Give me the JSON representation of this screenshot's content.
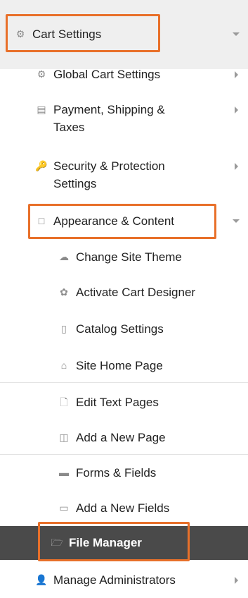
{
  "menu": {
    "cart_settings": {
      "label": "Cart Settings",
      "icon": "gear-icon"
    },
    "global_cart_settings": {
      "label": "Global Cart Settings",
      "icon": "gear-icon"
    },
    "payment_shipping_taxes": {
      "label_line1": "Payment, Shipping &",
      "label_line2": "Taxes",
      "icon": "register-icon"
    },
    "security_protection": {
      "label_line1": "Security & Protection",
      "label_line2": "Settings",
      "icon": "key-icon"
    },
    "appearance_content": {
      "label": "Appearance & Content",
      "icon": "monitor-icon"
    },
    "change_site_theme": {
      "label": "Change Site Theme",
      "icon": "cloud-icon"
    },
    "activate_cart_designer": {
      "label": "Activate Cart Designer",
      "icon": "palette-icon"
    },
    "catalog_settings": {
      "label": "Catalog Settings",
      "icon": "catalog-icon"
    },
    "site_home_page": {
      "label": "Site Home Page",
      "icon": "home-icon"
    },
    "edit_text_pages": {
      "label": "Edit Text Pages",
      "icon": "page-icon"
    },
    "add_new_page": {
      "label": "Add a New Page",
      "icon": "add-page-icon"
    },
    "forms_fields": {
      "label": "Forms & Fields",
      "icon": "form-icon"
    },
    "add_new_fields": {
      "label": "Add a New Fields",
      "icon": "add-field-icon"
    },
    "file_manager": {
      "label": "File Manager",
      "icon": "folder-icon"
    },
    "manage_administrators": {
      "label": "Manage Administrators",
      "icon": "user-icon"
    }
  },
  "colors": {
    "highlight": "#e8702a",
    "active_bg": "#4a4a4a",
    "section_bg": "#efefef"
  }
}
